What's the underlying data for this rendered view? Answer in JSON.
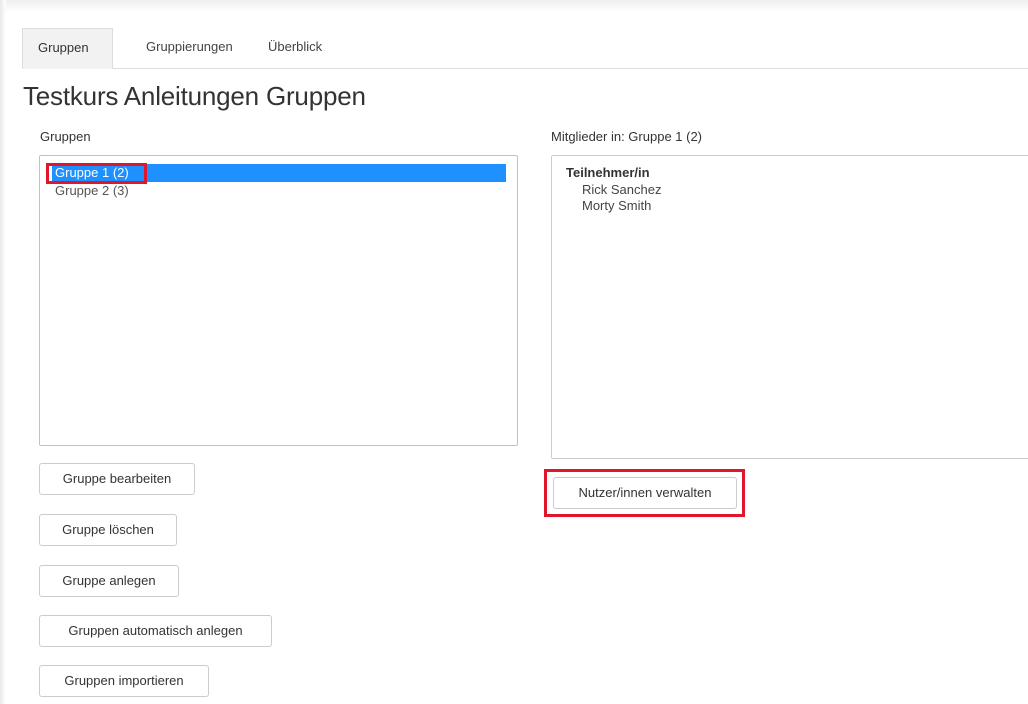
{
  "tabs": [
    {
      "label": "Gruppen",
      "active": true
    },
    {
      "label": "Gruppierungen",
      "active": false
    },
    {
      "label": "Überblick",
      "active": false
    }
  ],
  "page_title": "Testkurs Anleitungen Gruppen",
  "groups": {
    "label": "Gruppen",
    "options": [
      {
        "label": "Gruppe 1 (2)",
        "selected": true
      },
      {
        "label": "Gruppe 2 (3)",
        "selected": false
      }
    ]
  },
  "members": {
    "label": "Mitglieder in: Gruppe 1 (2)",
    "role": "Teilnehmer/in",
    "list": [
      "Rick Sanchez",
      "Morty Smith"
    ]
  },
  "buttons": {
    "edit": "Gruppe bearbeiten",
    "delete": "Gruppe löschen",
    "create": "Gruppe anlegen",
    "auto_create": "Gruppen automatisch anlegen",
    "import": "Gruppen importieren",
    "manage_users": "Nutzer/innen verwalten"
  },
  "colors": {
    "selection": "#1e90ff",
    "highlight": "#e0162b"
  }
}
